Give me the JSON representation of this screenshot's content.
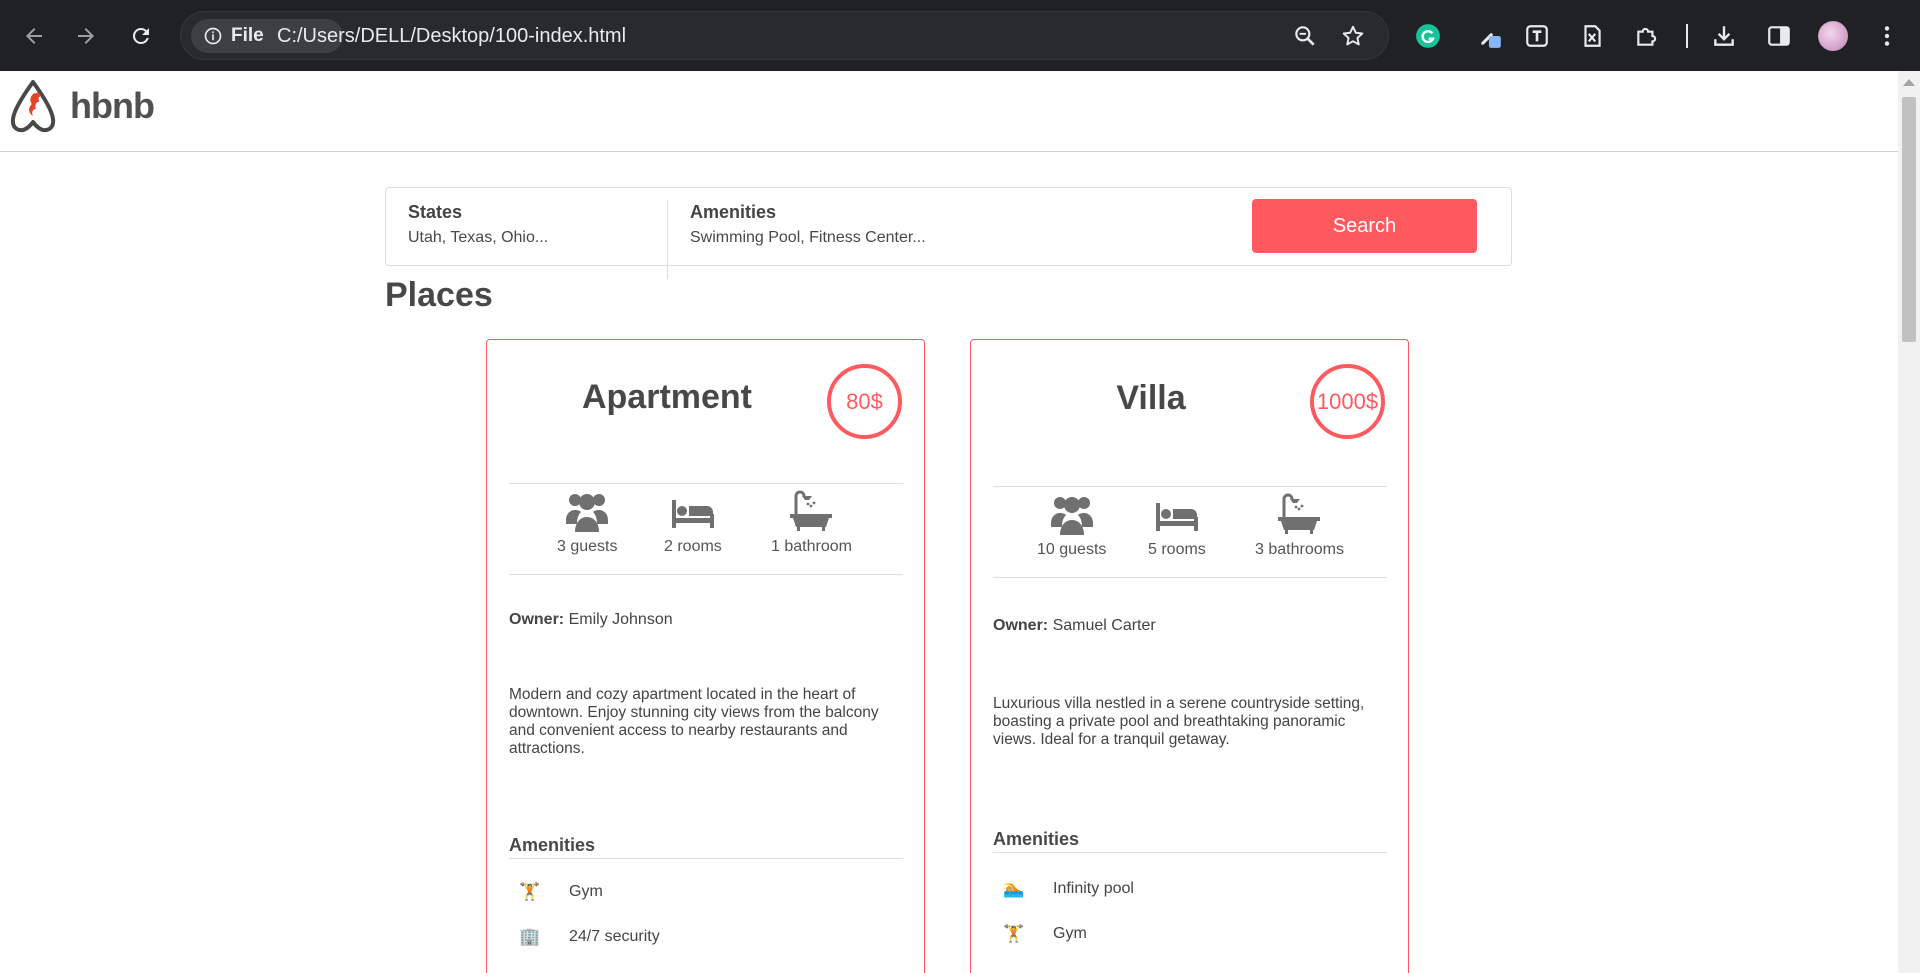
{
  "browser": {
    "chip_label": "File",
    "url": "C:/Users/DELL/Desktop/100-index.html"
  },
  "header": {
    "logo_text": "hbnb"
  },
  "filters": {
    "states_title": "States",
    "states_values": "Utah, Texas, Ohio...",
    "amenities_title": "Amenities",
    "amenities_values": "Swimming Pool, Fitness Center...",
    "search_label": "Search"
  },
  "places_title": "Places",
  "places": [
    {
      "title": "Apartment",
      "price": "80$",
      "guests": "3 guests",
      "rooms": "2 rooms",
      "bathrooms": "1 bathroom",
      "owner_label": "Owner:",
      "owner_name": "Emily Johnson",
      "description": "Modern and cozy apartment located in the heart of downtown. Enjoy stunning city views from the balcony and convenient access to nearby restaurants and attractions.",
      "amenities_title": "Amenities",
      "amenities": [
        {
          "icon": "gym-icon",
          "glyph": "🏋",
          "label": "Gym"
        },
        {
          "icon": "security-icon",
          "glyph": "🏢",
          "label": "24/7 security"
        }
      ]
    },
    {
      "title": "Villa",
      "price": "1000$",
      "guests": "10 guests",
      "rooms": "5 rooms",
      "bathrooms": "3 bathrooms",
      "owner_label": "Owner:",
      "owner_name": "Samuel Carter",
      "description": "Luxurious villa nestled in a serene countryside setting, boasting a private pool and breathtaking panoramic views. Ideal for a tranquil getaway.",
      "amenities_title": "Amenities",
      "amenities": [
        {
          "icon": "pool-icon",
          "glyph": "🏊",
          "label": "Infinity pool"
        },
        {
          "icon": "gym-icon",
          "glyph": "🏋",
          "label": "Gym"
        }
      ]
    }
  ]
}
